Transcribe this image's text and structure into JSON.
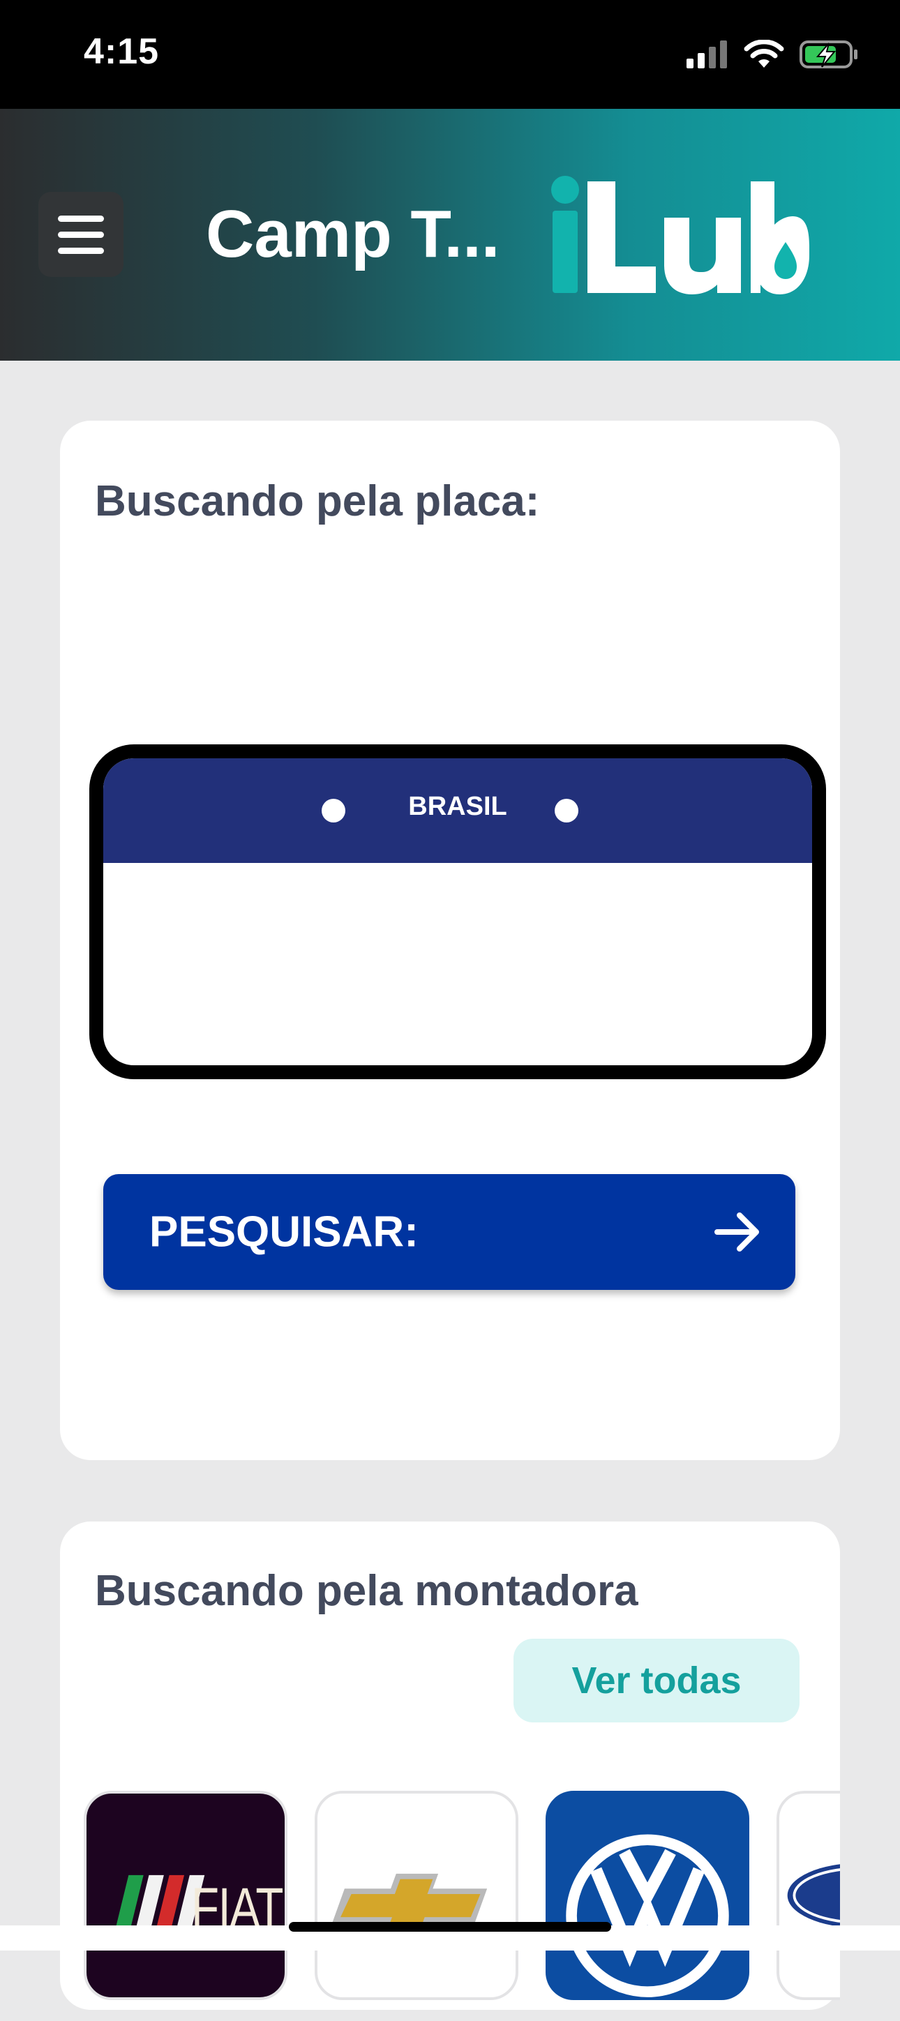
{
  "status_bar": {
    "time": "4:15"
  },
  "header": {
    "title": "Camp T...",
    "brand": "iLub"
  },
  "plate_card": {
    "title": "Buscando pela placa:",
    "plate_country": "BRASIL",
    "plate_value": "",
    "search_button": "PESQUISAR:"
  },
  "brands_card": {
    "title": "Buscando pela montadora",
    "see_all": "Ver todas",
    "brands": [
      "FIAT",
      "Chevrolet",
      "Volkswagen",
      "Ford"
    ]
  },
  "colors": {
    "header_gradient_end": "#10a9a9",
    "plate_blue": "#22307a",
    "button_blue": "#0034a0",
    "accent_teal": "#14a09d"
  }
}
